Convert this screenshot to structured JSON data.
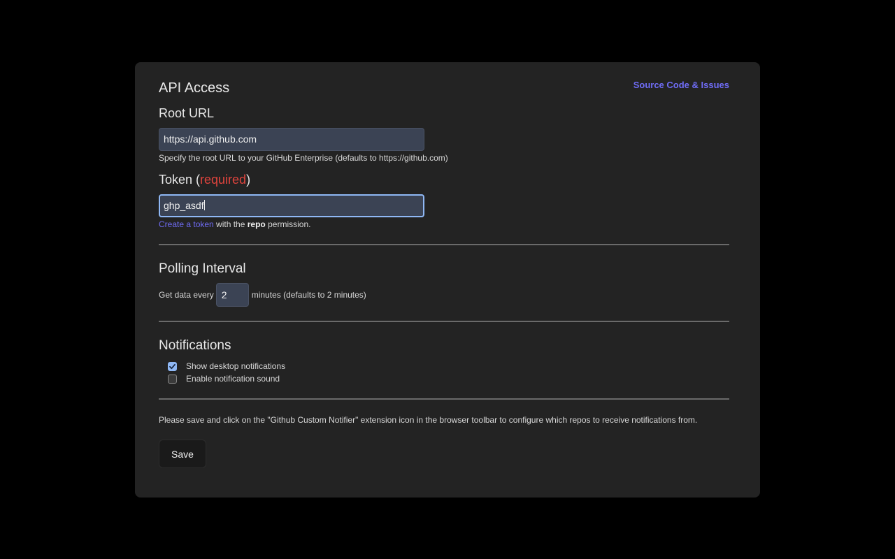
{
  "header": {
    "source_link": "Source Code & Issues"
  },
  "api_access": {
    "title": "API Access",
    "root_url": {
      "label": "Root URL",
      "value": "https://api.github.com",
      "help": "Specify the root URL to your GitHub Enterprise (defaults to https://github.com)"
    },
    "token": {
      "label_prefix": "Token (",
      "label_required": "required",
      "label_suffix": ")",
      "value": "ghp_asdf",
      "help_link": "Create a token",
      "help_middle": " with the ",
      "help_bold": "repo",
      "help_end": " permission."
    }
  },
  "polling": {
    "title": "Polling Interval",
    "prefix": "Get data every",
    "value": "2",
    "suffix": "minutes (defaults to 2 minutes)"
  },
  "notifications": {
    "title": "Notifications",
    "options": [
      {
        "label": "Show desktop notifications",
        "checked": true
      },
      {
        "label": "Enable notification sound",
        "checked": false
      }
    ]
  },
  "footer": {
    "note": "Please save and click on the \"Github Custom Notifier\" extension icon in the browser toolbar to configure which repos to receive notifications from.",
    "save_label": "Save"
  },
  "colors": {
    "link": "#6f6cf5",
    "required": "#e0443d",
    "focus": "#8fb8f5",
    "input_bg": "#3b4354",
    "panel_bg": "#232323"
  }
}
